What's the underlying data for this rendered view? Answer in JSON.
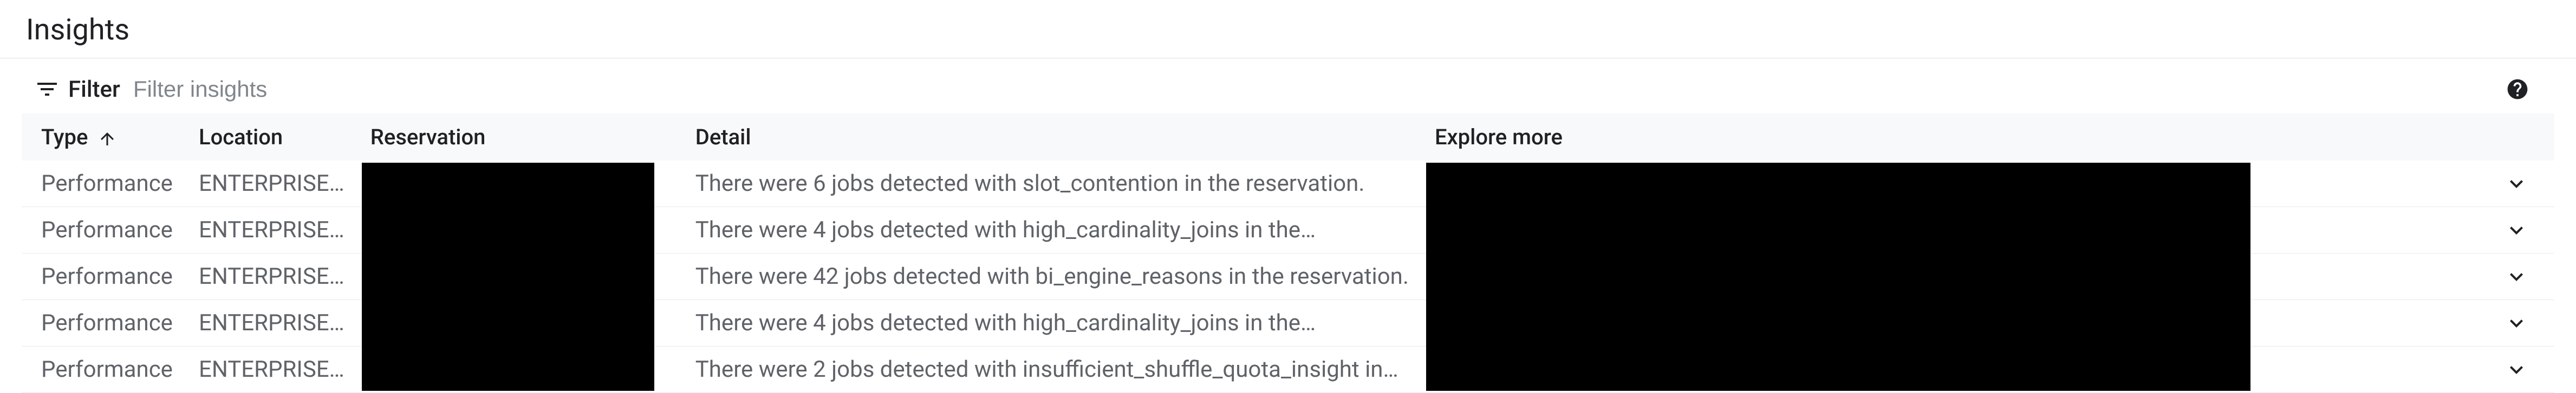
{
  "page": {
    "title": "Insights"
  },
  "filter": {
    "label": "Filter",
    "placeholder": "Filter insights"
  },
  "table": {
    "headers": {
      "type": "Type",
      "location": "Location",
      "reservation": "Reservation",
      "detail": "Detail",
      "explore": "Explore more"
    },
    "rows": [
      {
        "type": "Performance",
        "location": "ENTERPRISE…",
        "reservation": "",
        "detail": "There were 6 jobs detected with slot_contention in the reservation.",
        "explore": ""
      },
      {
        "type": "Performance",
        "location": "ENTERPRISE…",
        "reservation": "",
        "detail": "There were 4 jobs detected with high_cardinality_joins in the…",
        "explore": ""
      },
      {
        "type": "Performance",
        "location": "ENTERPRISE…",
        "reservation": "",
        "detail": "There were 42 jobs detected with bi_engine_reasons in the reservation.",
        "explore": ""
      },
      {
        "type": "Performance",
        "location": "ENTERPRISE…",
        "reservation": "",
        "detail": "There were 4 jobs detected with high_cardinality_joins in the…",
        "explore": ""
      },
      {
        "type": "Performance",
        "location": "ENTERPRISE…",
        "reservation": "",
        "detail": "There were 2 jobs detected with insufficient_shuffle_quota_insight in…",
        "explore": ""
      }
    ]
  }
}
